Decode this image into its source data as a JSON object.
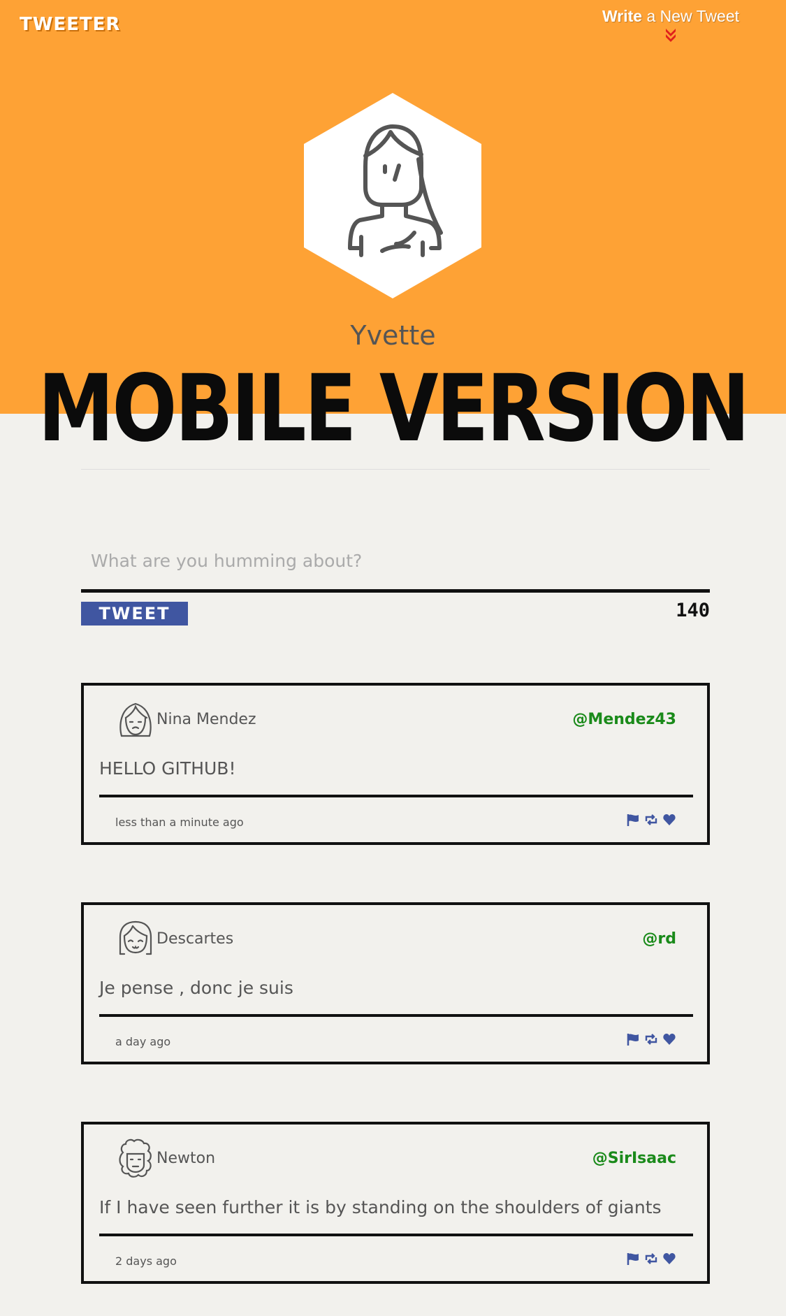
{
  "app": {
    "logo": "TWEETER"
  },
  "nav": {
    "compose_bold": "Write",
    "compose_rest": " a New Tweet"
  },
  "profile": {
    "name": "Yvette"
  },
  "overlay": {
    "banner": "MOBILE VERSION"
  },
  "composer": {
    "placeholder": "What are you humming about?",
    "button_label": "TWEET",
    "counter": "140"
  },
  "colors": {
    "header": "#fea235",
    "page": "#f2f1ed",
    "accent": "#4056a1",
    "handle": "#1a8a1a",
    "chevron": "#e0201c"
  },
  "tweets": [
    {
      "name": "Nina Mendez",
      "handle": "@Mendez43",
      "content": "HELLO GITHUB!",
      "time": "less than a minute ago",
      "avatar_icon": "girl-face-icon"
    },
    {
      "name": "Descartes",
      "handle": "@rd",
      "content": "Je pense , donc je suis",
      "time": "a day ago",
      "avatar_icon": "bob-hair-face-icon"
    },
    {
      "name": "Newton",
      "handle": "@SirIsaac",
      "content": "If I have seen further it is by standing on the shoulders of giants",
      "time": "2 days ago",
      "avatar_icon": "curly-wig-face-icon"
    }
  ],
  "action_icons": [
    "flag-icon",
    "retweet-icon",
    "heart-icon"
  ]
}
